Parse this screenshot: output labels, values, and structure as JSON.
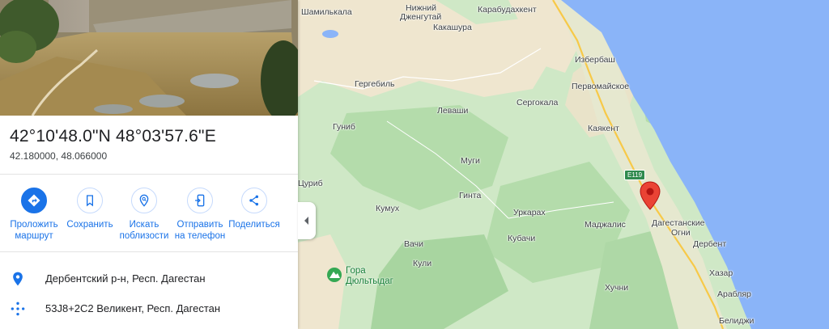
{
  "place": {
    "title": "42°10'48.0\"N 48°03'57.6\"E",
    "decimal": "42.180000, 48.066000"
  },
  "actions": [
    {
      "icon": "directions-icon",
      "line1": "Проложить",
      "line2": "маршрут"
    },
    {
      "icon": "bookmark-icon",
      "line1": "Сохранить",
      "line2": ""
    },
    {
      "icon": "nearby-icon",
      "line1": "Искать",
      "line2": "поблизости"
    },
    {
      "icon": "send-to-phone-icon",
      "line1": "Отправить",
      "line2": "на телефон"
    },
    {
      "icon": "share-icon",
      "line1": "Поделиться",
      "line2": ""
    }
  ],
  "info": {
    "address": "Дербентский р-н, Респ. Дагестан",
    "plus_code": "53J8+2C2 Великент, Респ. Дагестан"
  },
  "map": {
    "labels": {
      "shamilkala": "Шамилькала",
      "nizhny_dzhengutay": "Нижний",
      "nizhny_dzhengutay2": "Дженгутай",
      "karabudakhkent": "Карабудахкент",
      "kakashura": "Какашура",
      "izberbash": "Избербаш",
      "gergebil": "Гергебиль",
      "pervomayskoe": "Первомайское",
      "levashi": "Леваши",
      "sergokala": "Сергокала",
      "gunib": "Гуниб",
      "kayakent": "Каякент",
      "muga": "Муги",
      "tsurib": "Цуриб",
      "ginta": "Гинта",
      "kumukh": "Кумух",
      "urkarakh": "Уркарах",
      "madzhalis": "Маджалис",
      "dagestanskie": "Дагестанские",
      "ogni": "Огни",
      "kubachi": "Кубачи",
      "vachi": "Вачи",
      "derbent": "Дербент",
      "kuli": "Кули",
      "khazar": "Хазар",
      "khuchni": "Хучни",
      "arablyar": "Арабляр",
      "belidzhi": "Белиджи"
    },
    "peak": {
      "line1": "Гора",
      "line2": "Дюльтыдаг"
    },
    "road_shield": "E119",
    "colors": {
      "sea": "#8ab4f8",
      "land": "#cfe8c6",
      "forest": "#a8d5a0",
      "lowland": "#efe6cf",
      "pin": "#ea4335",
      "accent": "#1a73e8"
    }
  }
}
